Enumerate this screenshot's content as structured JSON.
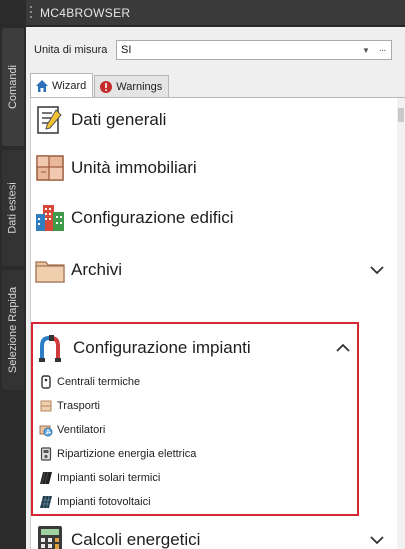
{
  "window": {
    "title": "MC4BROWSER"
  },
  "side_tabs": [
    {
      "label": "Comandi"
    },
    {
      "label": "Dati estesi"
    },
    {
      "label": "Selezione Rapida"
    }
  ],
  "units": {
    "label": "Unita di misura",
    "value": "SI",
    "more": "···"
  },
  "tabs": [
    {
      "label": "Wizard"
    },
    {
      "label": "Warnings"
    }
  ],
  "sections": {
    "dati_generali": "Dati generali",
    "unita_immobiliari": "Unità immobiliari",
    "configurazione_edifici": "Configurazione edifici",
    "archivi": "Archivi",
    "configurazione_impianti": "Configurazione impianti",
    "calcoli_energetici": "Calcoli energetici"
  },
  "impianti_items": [
    {
      "label": "Centrali termiche"
    },
    {
      "label": "Trasporti"
    },
    {
      "label": "Ventilatori"
    },
    {
      "label": "Ripartizione energia elettrica"
    },
    {
      "label": "Impianti solari termici"
    },
    {
      "label": "Impianti fotovoltaici"
    }
  ],
  "colors": {
    "highlight_border": "#d6262f",
    "dark_bg": "#2b2b2b",
    "panel_bg": "#efefef"
  }
}
